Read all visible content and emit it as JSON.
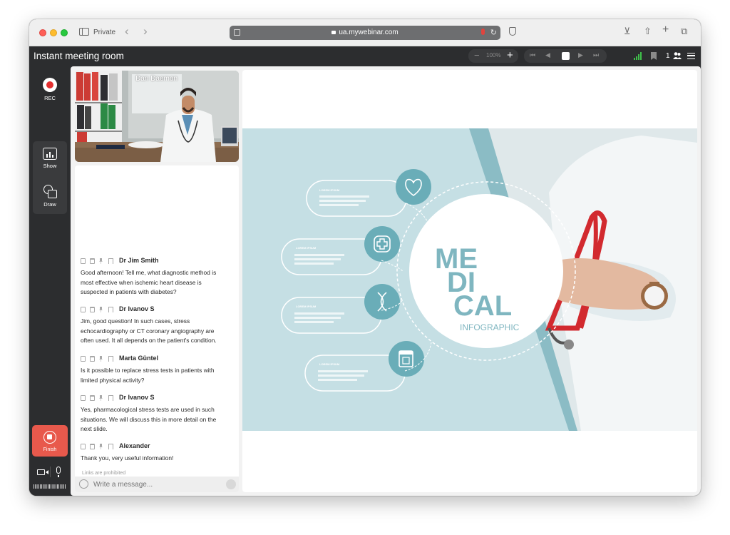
{
  "browser": {
    "mode_label": "Private",
    "url": "ua.mywebinar.com"
  },
  "app": {
    "title": "Instant meeting room",
    "zoom": "100%",
    "participants": "1"
  },
  "rail": {
    "rec_label": "REC",
    "show_label": "Show",
    "draw_label": "Draw",
    "finish_label": "Finish"
  },
  "video": {
    "speaker_name": "Dan Daemon"
  },
  "chat": {
    "messages": [
      {
        "author": "Dr Jim Smith",
        "text": "Good afternoon! Tell me, what diagnostic method is most effective when ischemic heart disease is suspected in patients with diabetes?"
      },
      {
        "author": "Dr Ivanov S",
        "text": "Jim, good question! In such cases, stress echocardiography or CT coronary angiography are often used. It all depends on the patient's condition."
      },
      {
        "author": "Marta Güntel",
        "text": "Is it possible to replace stress tests in patients with limited physical activity?"
      },
      {
        "author": "Dr Ivanov S",
        "text": "Yes, pharmacological stress tests are used in such situations. We will discuss this in more detail on the next slide."
      },
      {
        "author": "Alexander",
        "text": "Thank you, very useful information!"
      }
    ],
    "links_note": "Links are prohibited",
    "input_placeholder": "Write a message..."
  },
  "slide": {
    "title_line1": "ME",
    "title_line2": "DI",
    "title_line3": "CAL",
    "subtitle": "INFOGRAPHIC",
    "box_title": "LOREM IPSUM",
    "colors": {
      "bg": "#c5dfe4",
      "accent": "#6aadb8",
      "dark": "#7fb6c0"
    }
  }
}
